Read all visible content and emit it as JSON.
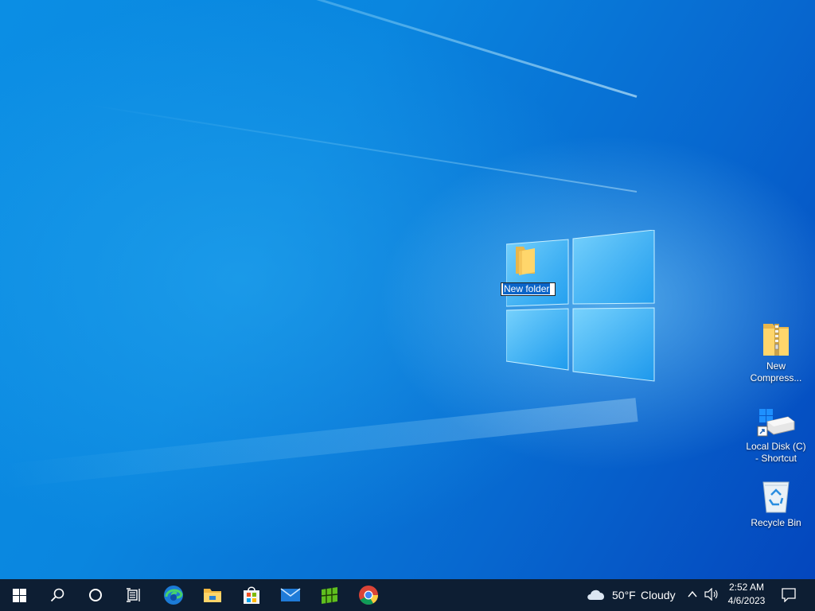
{
  "desktop": {
    "icons": [
      {
        "label": "New folder",
        "editing": true,
        "icon": "folder-icon"
      },
      {
        "label_line1": "New",
        "label_line2": "Compress...",
        "icon": "zip-folder-icon"
      },
      {
        "label_line1": "Local Disk (C)",
        "label_line2": "- Shortcut",
        "icon": "drive-shortcut-icon"
      },
      {
        "label": "Recycle Bin",
        "icon": "recycle-bin-icon"
      }
    ]
  },
  "taskbar": {
    "apps": [
      "start-icon",
      "search-icon",
      "cortana-icon",
      "task-view-icon",
      "edge-icon",
      "file-explorer-icon",
      "store-icon",
      "mail-icon",
      "app-icon",
      "chrome-icon"
    ],
    "weather": {
      "temp": "50°F",
      "condition": "Cloudy"
    },
    "clock": {
      "time": "2:52 AM",
      "date": "4/6/2023"
    }
  },
  "colors": {
    "taskbar_bg": "#0d1e33",
    "accent": "#0078d7"
  }
}
